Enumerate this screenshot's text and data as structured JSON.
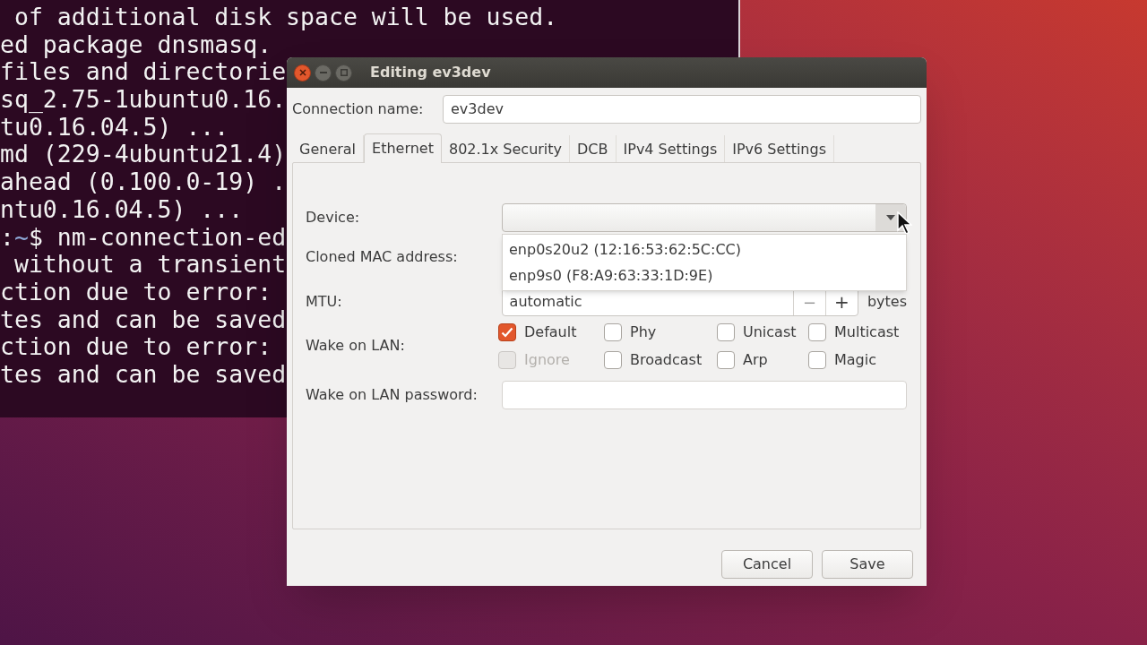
{
  "terminal": {
    "lines": [
      {
        "text": " of additional disk space will be used."
      },
      {
        "text": "ed package dnsmasq."
      },
      {
        "text": "files and directorie"
      },
      {
        "text": "sq_2.75-1ubuntu0.16."
      },
      {
        "text": "tu0.16.04.5) ..."
      },
      {
        "text": "md (229-4ubuntu21.4)"
      },
      {
        "text": "ahead (0.100.0-19) ."
      },
      {
        "text": "ntu0.16.04.5) ..."
      },
      {
        "kind": "prompt",
        "prefix": ":",
        "path": "~",
        "text": "$ nm-connection-ed"
      },
      {
        "text": " without a transient"
      },
      {
        "text": "ction due to error:"
      },
      {
        "text": "tes and can be saved"
      },
      {
        "text": "ction due to error:"
      },
      {
        "text": "tes and can be saved"
      }
    ]
  },
  "dialog": {
    "title": "Editing ev3dev",
    "connection_name": {
      "label": "Connection name:",
      "value": "ev3dev"
    },
    "tabs": [
      {
        "label": "General",
        "selected": false
      },
      {
        "label": "Ethernet",
        "selected": true
      },
      {
        "label": "802.1x Security",
        "selected": false
      },
      {
        "label": "DCB",
        "selected": false
      },
      {
        "label": "IPv4 Settings",
        "selected": false
      },
      {
        "label": "IPv6 Settings",
        "selected": false
      }
    ],
    "device": {
      "label": "Device:",
      "expanded": true,
      "options": [
        {
          "label": "enp0s20u2 (12:16:53:62:5C:CC)",
          "selected": false
        },
        {
          "label": "enp9s0 (F8:A9:63:33:1D:9E)",
          "selected": false
        }
      ]
    },
    "cloned_mac": {
      "label": "Cloned MAC address:"
    },
    "mtu": {
      "label": "MTU:",
      "value": "automatic",
      "decrement": "−",
      "increment": "+",
      "unit": "bytes"
    },
    "wake_on_lan": {
      "label": "Wake on LAN:",
      "options": [
        {
          "label": "Default",
          "checked": true,
          "disabled": false
        },
        {
          "label": "Phy",
          "checked": false,
          "disabled": false
        },
        {
          "label": "Unicast",
          "checked": false,
          "disabled": false
        },
        {
          "label": "Multicast",
          "checked": false,
          "disabled": false
        },
        {
          "label": "Ignore",
          "checked": false,
          "disabled": true
        },
        {
          "label": "Broadcast",
          "checked": false,
          "disabled": false
        },
        {
          "label": "Arp",
          "checked": false,
          "disabled": false
        },
        {
          "label": "Magic",
          "checked": false,
          "disabled": false
        }
      ]
    },
    "wol_password": {
      "label": "Wake on LAN password:"
    },
    "buttons": [
      "Cancel",
      "Save"
    ]
  }
}
